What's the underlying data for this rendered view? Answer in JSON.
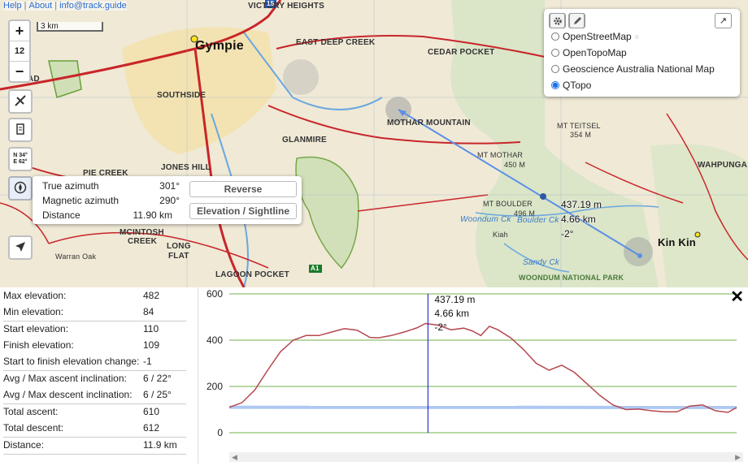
{
  "topbar": {
    "help": "Help",
    "about": "About",
    "email": "info@track.guide"
  },
  "zoom": {
    "in_label": "+",
    "level": "12",
    "out_label": "−"
  },
  "scale_label": "3 km",
  "coord_button": {
    "line1": "N 34°",
    "line2": "E 62°"
  },
  "map_labels": {
    "victory_heights": "VICTORY HEIGHTS",
    "gympie": "Gympie",
    "east_deep_creek": "EAST DEEP CREEK",
    "cedar_pocket": "CEDAR POCKET",
    "southside": "SOUTHSIDE",
    "mothar_mountain": "MOTHAR MOUNTAIN",
    "glanmire": "GLANMIRE",
    "mt_teitsel": "MT TEITSEL",
    "mt_teitsel_h": "354 M",
    "mt_mothar": "MT MOTHAR",
    "mt_mothar_h": "450 M",
    "pie_creek": "PIE CREEK",
    "jones_hill": "JONES HILL",
    "mt_boulder": "MT BOULDER",
    "mt_boulder_h": "496 M",
    "mcintosh_creek": "MCINTOSH",
    "mcintosh_creek2": "CREEK",
    "long_flat": "LONG",
    "long_flat2": "FLAT",
    "warran_oak": "Warran Oak",
    "lagoon_pocket": "LAGOON POCKET",
    "woondum_np": "WOONDUM NATIONAL PARK",
    "kin_kin": "Kin Kin",
    "kiah": "Kiah",
    "woondum_ck": "Woondum Ck",
    "boulder_ck": "Boulder Ck",
    "sandy_ck": "Sandy Ck",
    "ad": "AD",
    "wahpunga": "WAHPUNGA",
    "a1": "A1",
    "m15": "15"
  },
  "layers": {
    "options": [
      {
        "label": "OpenStreetMap",
        "selected": false
      },
      {
        "label": "OpenTopoMap",
        "selected": false
      },
      {
        "label": "Geoscience Australia National Map",
        "selected": false
      },
      {
        "label": "QTopo",
        "selected": true
      }
    ]
  },
  "azimuth": {
    "true_label": "True azimuth",
    "true_value": "301°",
    "magnetic_label": "Magnetic azimuth",
    "magnetic_value": "290°",
    "distance_label": "Distance",
    "distance_value": "11.90 km",
    "reverse_button": "Reverse",
    "elevation_button": "Elevation / Sightline"
  },
  "line_tooltip": {
    "elevation": "437.19 m",
    "distance": "4.66 km",
    "angle": "-2°"
  },
  "stats": [
    {
      "label": "Max elevation:",
      "value": "482"
    },
    {
      "label": "Min elevation:",
      "value": "84"
    },
    {
      "label": "Start elevation:",
      "value": "110"
    },
    {
      "label": "Finish elevation:",
      "value": "109"
    },
    {
      "label": "Start to finish elevation change:",
      "value": "-1"
    },
    {
      "label": "Avg / Max ascent inclination:",
      "value": "6 / 22°"
    },
    {
      "label": "Avg / Max descent inclination:",
      "value": "6 / 25°"
    },
    {
      "label": "Total ascent:",
      "value": "610"
    },
    {
      "label": "Total descent:",
      "value": "612"
    },
    {
      "label": "Distance:",
      "value": "11.9 km"
    }
  ],
  "chart_data": {
    "type": "area",
    "ylim": [
      0,
      600
    ],
    "yticks": [
      "0",
      "200",
      "400",
      "600"
    ],
    "xlim": [
      0,
      11.9
    ],
    "grid": true,
    "colors": {
      "profile": "#b5484f",
      "sightline": "#aec8f2",
      "cursor": "#1010c8",
      "grid": "#6fb24a"
    },
    "profile": [
      [
        0,
        110
      ],
      [
        0.3,
        130
      ],
      [
        0.6,
        185
      ],
      [
        0.9,
        270
      ],
      [
        1.2,
        350
      ],
      [
        1.5,
        400
      ],
      [
        1.8,
        420
      ],
      [
        2.1,
        420
      ],
      [
        2.4,
        435
      ],
      [
        2.7,
        450
      ],
      [
        3.0,
        443
      ],
      [
        3.3,
        412
      ],
      [
        3.5,
        410
      ],
      [
        3.8,
        420
      ],
      [
        4.1,
        435
      ],
      [
        4.4,
        453
      ],
      [
        4.6,
        472
      ],
      [
        4.9,
        465
      ],
      [
        5.2,
        445
      ],
      [
        5.5,
        452
      ],
      [
        5.7,
        440
      ],
      [
        5.9,
        420
      ],
      [
        6.1,
        460
      ],
      [
        6.3,
        445
      ],
      [
        6.6,
        410
      ],
      [
        6.9,
        360
      ],
      [
        7.2,
        300
      ],
      [
        7.5,
        270
      ],
      [
        7.8,
        292
      ],
      [
        8.1,
        260
      ],
      [
        8.4,
        210
      ],
      [
        8.7,
        160
      ],
      [
        9.0,
        120
      ],
      [
        9.3,
        100
      ],
      [
        9.6,
        102
      ],
      [
        9.9,
        95
      ],
      [
        10.2,
        90
      ],
      [
        10.5,
        90
      ],
      [
        10.8,
        115
      ],
      [
        11.1,
        120
      ],
      [
        11.4,
        95
      ],
      [
        11.7,
        88
      ],
      [
        11.9,
        109
      ]
    ],
    "sightline": [
      [
        0,
        110
      ],
      [
        11.9,
        109
      ]
    ],
    "cursor": {
      "x": 4.66,
      "value": "437.19 m",
      "distance": "4.66 km",
      "angle": "-2°"
    }
  }
}
